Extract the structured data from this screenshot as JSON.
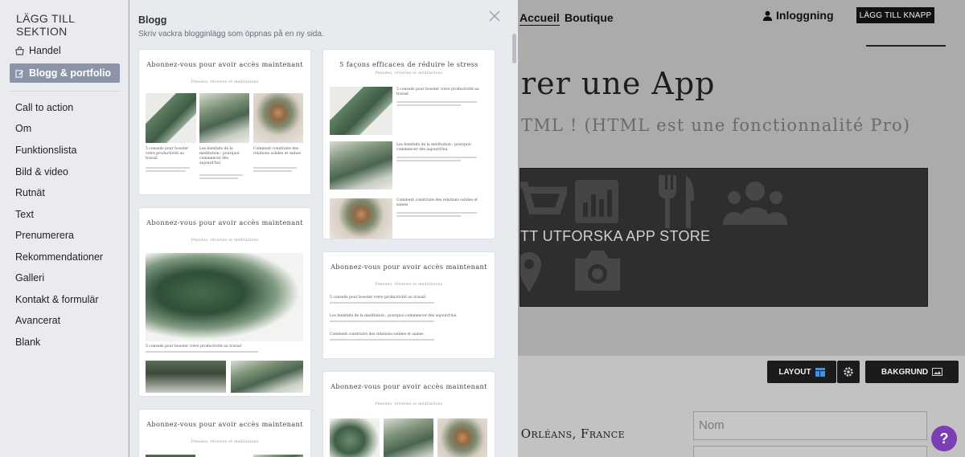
{
  "sidebar": {
    "title": "LÄGG TILL SEKTION",
    "items": [
      {
        "label": "Handel",
        "icon": "shop-icon"
      },
      {
        "label": "Blogg & portfolio",
        "icon": "edit-icon"
      },
      {
        "label": "Call to action"
      },
      {
        "label": "Om"
      },
      {
        "label": "Funktionslista"
      },
      {
        "label": "Bild & video"
      },
      {
        "label": "Rutnät"
      },
      {
        "label": "Text"
      },
      {
        "label": "Prenumerera"
      },
      {
        "label": "Rekommendationer"
      },
      {
        "label": "Galleri"
      },
      {
        "label": "Kontakt & formulär"
      },
      {
        "label": "Avancerat"
      },
      {
        "label": "Blank"
      }
    ],
    "active_index": 1
  },
  "panel": {
    "title": "Blogg",
    "subtitle": "Skriv vackra blogginlägg som öppnas på en ny sida."
  },
  "cards": {
    "c1": {
      "title": "Abonnez-vous pour avoir accès maintenant",
      "tag": "Pensées, rêveries et méditations",
      "captions": [
        "5 conseils pour booster votre productivité au travail",
        "Les bienfaits de la méditation : pourquoi commencer dès aujourd'hui",
        "Comment construire des relations solides et saines"
      ]
    },
    "c2": {
      "title": "5 façons efficaces de réduire le stress",
      "tag": "Pensées, rêveries et méditations",
      "captions": [
        "5 conseils pour booster votre productivité au travail",
        "Les bienfaits de la méditation : pourquoi commencer dès aujourd'hui",
        "Comment construire des relations solides et saines"
      ]
    },
    "c3": {
      "title": "Abonnez-vous pour avoir accès maintenant",
      "tag": "Pensées, rêveries et méditations",
      "caption": "5 conseils pour booster votre productivité au travail"
    },
    "c4": {
      "title": "Abonnez-vous pour avoir accès maintenant",
      "tag": "Pensées, rêveries et méditations",
      "captions": [
        "5 conseils pour booster votre productivité au travail",
        "Les bienfaits de la méditation : pourquoi commencer dès aujourd'hui",
        "Comment construire des relations solides et saines"
      ]
    },
    "c5": {
      "title": "Abonnez-vous pour avoir accès maintenant",
      "tag": "Pensées, rêveries et méditations"
    },
    "c6": {
      "title": "Abonnez-vous pour avoir accès maintenant",
      "tag": "Pensées, rêveries et méditations"
    }
  },
  "site": {
    "nav": [
      "Accueil",
      "Boutique"
    ],
    "login_label": "Inloggning",
    "add_button": "LÄGG TILL KNAPP",
    "hero_title": "rer une App",
    "hero_subtitle": "TML ! (HTML est une fonctionnalité Pro)",
    "banner_text": "TT UTFORSKA APP STORE",
    "layout_button": "LAYOUT",
    "background_button": "BAKGRUND",
    "address": "o, Orléans, France",
    "field_name_placeholder": "Nom",
    "help_label": "?"
  },
  "colors": {
    "accent_active": "#8c95a8",
    "help": "#7b3fb5"
  }
}
